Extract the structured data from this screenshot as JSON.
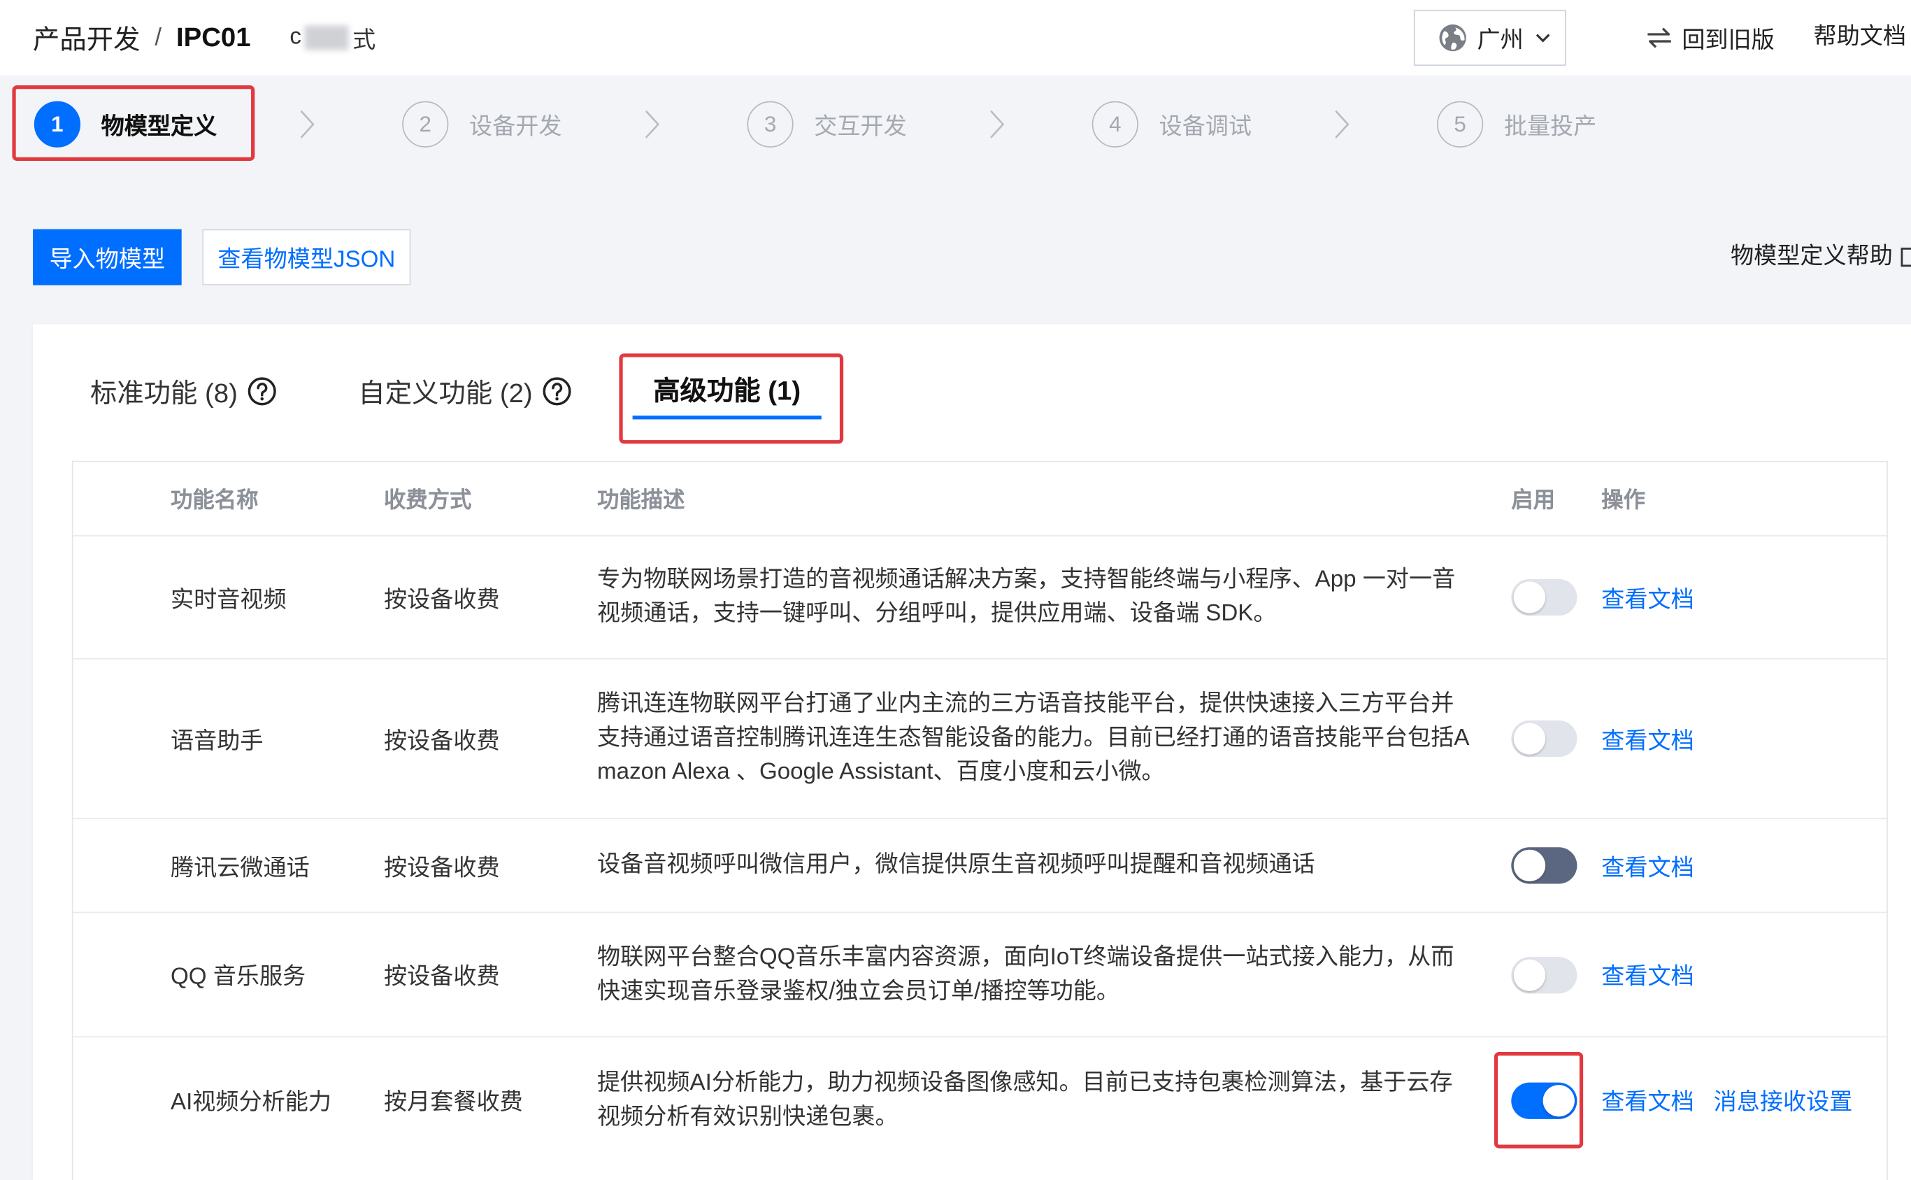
{
  "breadcrumb": {
    "root": "产品开发",
    "separator": "/",
    "product": "IPC01",
    "subtitle_prefix": "c",
    "subtitle_suffix": "式"
  },
  "region": {
    "label": "广州"
  },
  "header_links": {
    "old_version": "回到旧版",
    "help_docs": "帮助文档"
  },
  "steps": [
    {
      "number": "1",
      "label": "物模型定义",
      "active": true
    },
    {
      "number": "2",
      "label": "设备开发",
      "active": false
    },
    {
      "number": "3",
      "label": "交互开发",
      "active": false
    },
    {
      "number": "4",
      "label": "设备调试",
      "active": false
    },
    {
      "number": "5",
      "label": "批量投产",
      "active": false
    }
  ],
  "toolbar": {
    "import_button": "导入物模型",
    "view_json_button": "查看物模型JSON",
    "help_link": "物模型定义帮助"
  },
  "tabs": [
    {
      "label": "标准功能 (8)",
      "active": false
    },
    {
      "label": "自定义功能 (2)",
      "active": false
    },
    {
      "label": "高级功能 (1)",
      "active": true
    }
  ],
  "table": {
    "columns": [
      "功能名称",
      "收费方式",
      "功能描述",
      "启用",
      "操作"
    ],
    "rows": [
      {
        "name": "实时音视频",
        "billing": "按设备收费",
        "desc": [
          "专为物联网场景打造的音视频通话解决方案，支持智能终端与小程序、App 一对一音",
          "视频通话，支持一键呼叫、分组呼叫，提供应用端、设备端 SDK。"
        ],
        "enabled": false,
        "actions": [
          "查看文档"
        ]
      },
      {
        "name": "语音助手",
        "billing": "按设备收费",
        "desc": [
          "腾讯连连物联网平台打通了业内主流的三方语音技能平台，提供快速接入三方平台并",
          "支持通过语音控制腾讯连连生态智能设备的能力。目前已经打通的语音技能平台包括A",
          "mazon Alexa 、Google Assistant、百度小度和云小微。"
        ],
        "enabled": false,
        "actions": [
          "查看文档"
        ]
      },
      {
        "name": "腾讯云微通话",
        "billing": "按设备收费",
        "desc": [
          "设备音视频呼叫微信用户，微信提供原生音视频呼叫提醒和音视频通话"
        ],
        "enabled": false,
        "actions": [
          "查看文档"
        ]
      },
      {
        "name": "QQ 音乐服务",
        "billing": "按设备收费",
        "desc": [
          "物联网平台整合QQ音乐丰富内容资源，面向IoT终端设备提供一站式接入能力，从而",
          "快速实现音乐登录鉴权/独立会员订单/播控等功能。"
        ],
        "enabled": false,
        "actions": [
          "查看文档"
        ]
      },
      {
        "name": "AI视频分析能力",
        "billing": "按月套餐收费",
        "desc": [
          "提供视频AI分析能力，助力视频设备图像感知。目前已支持包裹检测算法，基于云存",
          "视频分析有效识别快递包裹。"
        ],
        "enabled": true,
        "actions": [
          "查看文档",
          "消息接收设置"
        ]
      }
    ]
  },
  "colors": {
    "accent": "#006eff",
    "highlight_box": "#e2383f",
    "page_background": "#f3f4f7",
    "toggle_off": "#e1e4ea",
    "toggle_hover": "#5b6780"
  },
  "icons": {
    "region": "globe-icon",
    "region_dropdown": "chevron-down-icon",
    "old_version": "swap-arrows-icon",
    "step_separator": "chevron-right-icon",
    "help_link": "external-link-icon",
    "tab_help": "question-circle-icon"
  }
}
